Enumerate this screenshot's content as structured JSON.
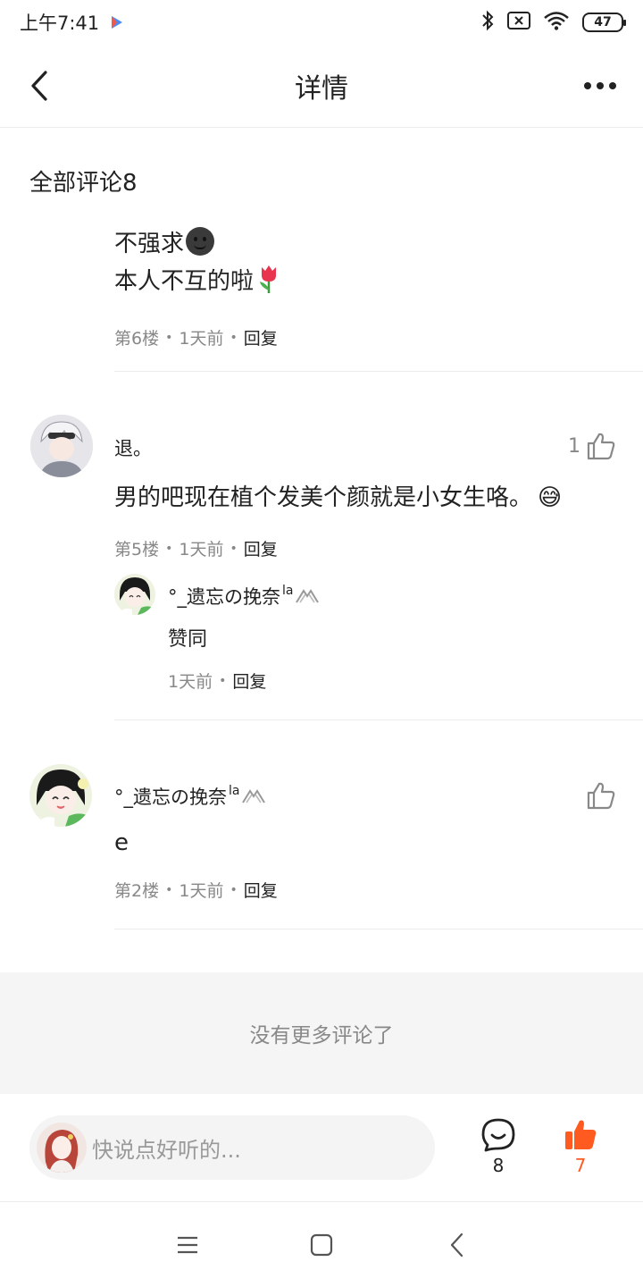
{
  "status_bar": {
    "time": "上午7:41",
    "battery": "47"
  },
  "header": {
    "title": "详情"
  },
  "section": {
    "title": "全部评论8"
  },
  "comments": [
    {
      "line1": "不强求",
      "emoji1": "🌚",
      "line2": "本人不互的啦",
      "emoji2": "🌷",
      "floor": "第6楼",
      "time": "1天前",
      "reply": "回复"
    },
    {
      "user": "退。",
      "likes": "1",
      "text": "男的吧现在植个发美个颜就是小女生咯。",
      "emoji": "😅",
      "floor": "第5楼",
      "time": "1天前",
      "reply": "回复",
      "sub_reply": {
        "user": "°_遗忘の挽奈",
        "user_sup": "la",
        "text": "赞同",
        "time": "1天前",
        "reply": "回复"
      }
    },
    {
      "user": "°_遗忘の挽奈",
      "user_sup": "la",
      "text": "e",
      "floor": "第2楼",
      "time": "1天前",
      "reply": "回复"
    }
  ],
  "no_more": "没有更多评论了",
  "bottom_bar": {
    "placeholder": "快说点好听的...",
    "comment_count": "8",
    "like_count": "7"
  },
  "colors": {
    "accent": "#ff5a1f",
    "muted": "#888888",
    "text": "#222222"
  },
  "icons": {
    "back": "back-arrow-icon",
    "more": "more-dots-icon",
    "thumb": "thumb-up-icon",
    "comment": "comment-bubble-icon"
  }
}
